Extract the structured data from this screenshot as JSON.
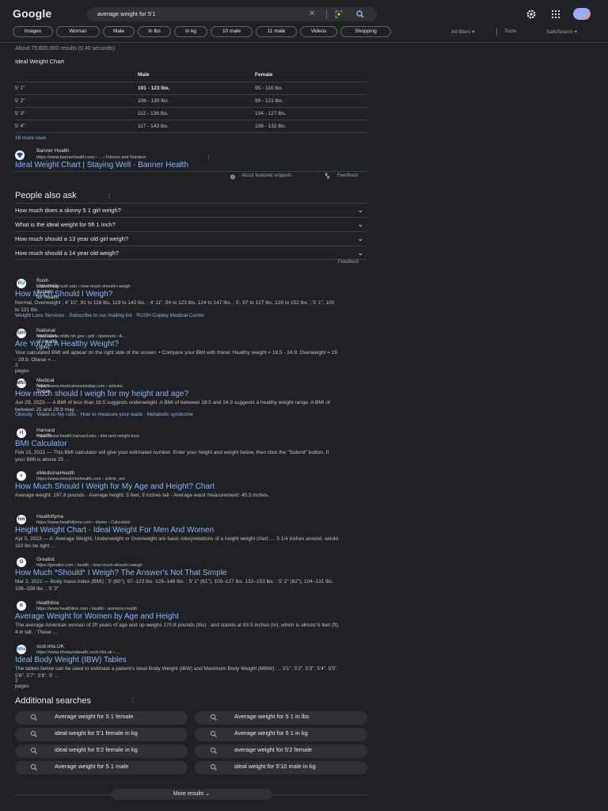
{
  "header": {
    "logo": "Google",
    "query": "average weight for 5'1",
    "clear_glyph": "✕",
    "icons": [
      "clear-icon",
      "google-lens-icon",
      "search-icon",
      "settings-icon",
      "apps-icon",
      "avatar"
    ]
  },
  "chips": [
    "Images",
    "Woman",
    "Male",
    "In lbs",
    "In kg",
    "10 male",
    "11 male",
    "Videos",
    "Shopping"
  ],
  "tools": {
    "all_filters": "All filters ▾",
    "tools": "Tools",
    "safesearch": "SafeSearch ▾"
  },
  "stats": "About 75,600,000 results (0.40 seconds)",
  "featured": {
    "title": "Ideal Weight Chart",
    "headers": [
      "",
      "Male",
      "Female"
    ],
    "rows": [
      [
        "5' 1\"",
        "101 - 123 lbs.",
        "95 - 116 lbs."
      ],
      [
        "5' 2\"",
        "106 - 130 lbs.",
        "99 - 121 lbs."
      ],
      [
        "5' 3\"",
        "112 - 136 lbs.",
        "104 - 127 lbs."
      ],
      [
        "5' 4\"",
        "117 - 143 lbs.",
        "108 - 132 lbs."
      ]
    ],
    "more_rows": "28 more rows",
    "source_site": "Banner Health",
    "source_url": "https://www.bannerhealth.com › ... › Fitness and Nutrition",
    "source_title": "Ideal Weight Chart | Staying Well - Banner Health",
    "about": "About featured snippets",
    "feedback": "Feedback"
  },
  "paa": {
    "title": "People also ask",
    "questions": [
      "How much does a skinny 5 1 girl weigh?",
      "What is the ideal weight for 5ft 1 inch?",
      "How much should a 13 year old girl weigh?",
      "How much should a 14 year old weigh?"
    ],
    "feedback": "Feedback"
  },
  "results": [
    {
      "site": "Rush University System for Health",
      "url": "https://www.rush.edu › how-much-should-i-weigh",
      "title": "How Much Should I Weigh?",
      "snippet": "Normal, Overweight ; 4' 10\", 91 to 118 lbs. 119 to 142 lbs. ; 4' 11\", 94 to 123 lbs. 124 to 147 lbs. ; 5', 97 to 127 lbs. 128 to 152 lbs. ; 5' 1\", 100 to 131 lbs.",
      "links": "Weight Loss Services · Subscribe to our mailing list · RUSH Copley Medical Center",
      "fav": "RU",
      "favcolor": "#0c8a3e"
    },
    {
      "site": "National Institutes of Health (.gov)",
      "url": "https://www.nhlbi.nih.gov › pdf › tipsheets › A...",
      "title": "Are You At A Healthy Weight?",
      "snippet": "Your calculated BMI will appear on the right side of the screen. • Compare your BMI with these: Healthy weight = 18.5 - 24.9. Overweight = 25 - 29.9. Obese = ...",
      "links": "2 pages",
      "fav": "NIH",
      "favcolor": "#20558a"
    },
    {
      "site": "Medical News Today",
      "url": "https://www.medicalnewstoday.com › articles",
      "title": "How much should I weigh for my height and age?",
      "snippet": "Jun 29, 2023 — A BMI of less than 18.5 suggests underweight. A BMI of between 18.5 and 24.9 suggests a healthy weight range. A BMI of between 25 and 29.9 may ...",
      "links": "Obesity · Waist-to-hip ratio · How to measure your waist · Metabolic syndrome",
      "fav": "MNT",
      "favcolor": "#202124"
    },
    {
      "site": "Harvard Health",
      "url": "https://www.health.harvard.edu › diet-and-weight-loss",
      "title": "BMI Calculator",
      "snippet": "Feb 15, 2021 — This BMI calculator will give your estimated number. Enter your height and weight below, then click the \"Submit\" button. If your BMI is above 25 ...",
      "links": "",
      "fav": "H",
      "favcolor": "#a51c30"
    },
    {
      "site": "eMedicineHealth",
      "url": "https://www.emedicinehealth.com › article_em",
      "title": "How Much Should I Weigh for My Age and Height? Chart",
      "snippet": "Average weight: 197.8 pounds · Average height: 5 feet, 9 inches tall · Average waist measurement: 40.3 inches.",
      "links": "",
      "fav": "e",
      "favcolor": "#2a6db2"
    },
    {
      "site": "Healthifyme",
      "url": "https://www.healthifyme.com › Home › Calculator",
      "title": "Height Weight Chart - Ideal Weight For Men And Women",
      "snippet": "Apr 5, 2023 — A: Average Weight, Underweight or Overweight are basic interpretations of a height weight chart. ... 5 1/4 inches around, would 110 lbs be light ...",
      "links": "",
      "fav": "hm",
      "favcolor": "#202124"
    },
    {
      "site": "Greatist",
      "url": "https://greatist.com › health › how-much-should-i-weigh",
      "title": "How Much *Should* I Weigh? The Answer's Not That Simple",
      "snippet": "Mar 2, 2021 — Body mass index (BMI) ; 5' (60\"), 97–123 lbs. 128–148 lbs. ; 5' 1\" (61\"), 100–127 lbs. 132–153 lbs. ; 5' 2\" (62\"), 104–131 lbs. 136–158 lbs. ; 5' 3\"",
      "links": "",
      "fav": "G",
      "favcolor": "#202124"
    },
    {
      "site": "Healthline",
      "url": "https://www.healthline.com › health › womens-health",
      "title": "Average Weight for Women by Age and Height",
      "snippet": "The average American woman of 20 years of age and up weighs 170.8 pounds (lbs) · and stands at 63.5 inches (in), which is almost 5 feet (ft), 4 in tall. ; These ...",
      "links": "",
      "fav": "h",
      "favcolor": "#202124"
    },
    {
      "site": "scot.nhs.UK",
      "url": "https://www.nhstaysideadtc.scot.nhs.uk › ...",
      "title": "Ideal Body Weight (IBW) Tables",
      "snippet": "The tables below can be used to estimate a patient's Ideal Body Weight (IBW) and Maximum Body Weight (MBW). ... 5'1\". 5'2\". 5'3\". 5'4\". 5'5\". 5'6\". 5'7\". 5'8\". 5' ...",
      "links": "2 pages",
      "fav": "nhs",
      "favcolor": "#005eb8"
    }
  ],
  "additional": {
    "title": "Additional searches",
    "items": [
      "Average weight for 5 1 female",
      "Average weight for 5 1 in lbs",
      "ideal weight for 5'1 female in kg",
      "Average weight for 5 1 in kg",
      "ideal weight for 5'2 female in kg",
      "average weight for 5'2 female",
      "Average weight for 5 1 male",
      "ideal weight for 5'10 male in kg"
    ]
  },
  "more_results": "More results ⌄"
}
